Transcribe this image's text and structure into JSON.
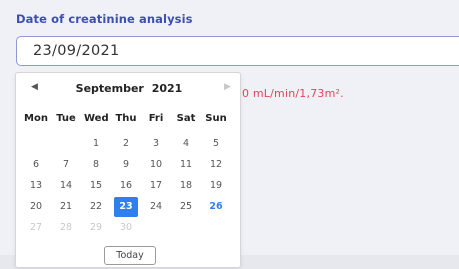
{
  "field": {
    "label": "Date of creatinine analysis",
    "value": "23/09/2021"
  },
  "error_text": "0 mL/min/1,73m².",
  "calendar": {
    "prev_icon": "◀",
    "next_icon": "▶",
    "month": "September",
    "year": "2021",
    "weekdays": [
      "Mon",
      "Tue",
      "Wed",
      "Thu",
      "Fri",
      "Sat",
      "Sun"
    ],
    "weeks": [
      [
        {
          "day": "",
          "state": "empty"
        },
        {
          "day": "",
          "state": "empty"
        },
        {
          "day": "1",
          "state": "normal"
        },
        {
          "day": "2",
          "state": "normal"
        },
        {
          "day": "3",
          "state": "normal"
        },
        {
          "day": "4",
          "state": "normal"
        },
        {
          "day": "5",
          "state": "normal"
        }
      ],
      [
        {
          "day": "6",
          "state": "normal"
        },
        {
          "day": "7",
          "state": "normal"
        },
        {
          "day": "8",
          "state": "normal"
        },
        {
          "day": "9",
          "state": "normal"
        },
        {
          "day": "10",
          "state": "normal"
        },
        {
          "day": "11",
          "state": "normal"
        },
        {
          "day": "12",
          "state": "normal"
        }
      ],
      [
        {
          "day": "13",
          "state": "normal"
        },
        {
          "day": "14",
          "state": "normal"
        },
        {
          "day": "15",
          "state": "normal"
        },
        {
          "day": "16",
          "state": "normal"
        },
        {
          "day": "17",
          "state": "normal"
        },
        {
          "day": "18",
          "state": "normal"
        },
        {
          "day": "19",
          "state": "normal"
        }
      ],
      [
        {
          "day": "20",
          "state": "normal"
        },
        {
          "day": "21",
          "state": "normal"
        },
        {
          "day": "22",
          "state": "normal"
        },
        {
          "day": "23",
          "state": "selected"
        },
        {
          "day": "24",
          "state": "normal"
        },
        {
          "day": "25",
          "state": "normal"
        },
        {
          "day": "26",
          "state": "today"
        }
      ],
      [
        {
          "day": "27",
          "state": "outside"
        },
        {
          "day": "28",
          "state": "outside"
        },
        {
          "day": "29",
          "state": "outside"
        },
        {
          "day": "30",
          "state": "outside"
        },
        {
          "day": "",
          "state": "empty"
        },
        {
          "day": "",
          "state": "empty"
        },
        {
          "day": "",
          "state": "empty"
        }
      ]
    ],
    "today_label": "Today"
  },
  "colors": {
    "label": "#3d4fb5",
    "error": "#e0445c",
    "selected_bg": "#2f80ed",
    "today_text": "#2f80ed"
  }
}
